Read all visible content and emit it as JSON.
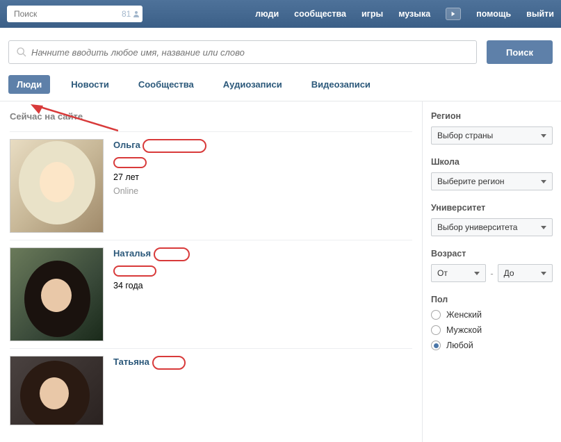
{
  "topNav": {
    "searchPlaceholder": "Поиск",
    "friendCount": "81",
    "links": {
      "people": "люди",
      "communities": "сообщества",
      "games": "игры",
      "music": "музыка",
      "help": "помощь",
      "logout": "выйти"
    }
  },
  "bigSearch": {
    "placeholder": "Начните вводить любое имя, название или слово",
    "button": "Поиск"
  },
  "tabs": {
    "people": "Люди",
    "news": "Новости",
    "communities": "Сообщества",
    "audio": "Аудиозаписи",
    "video": "Видеозаписи"
  },
  "sectionTitle": "Сейчас на сайте",
  "results": [
    {
      "name": "Ольга",
      "age": "27 лет",
      "status": "Online"
    },
    {
      "name": "Наталья",
      "age": "34 года",
      "status": ""
    },
    {
      "name": "Татьяна",
      "age": "",
      "status": ""
    }
  ],
  "filters": {
    "region": {
      "label": "Регион",
      "value": "Выбор страны"
    },
    "school": {
      "label": "Школа",
      "value": "Выберите регион"
    },
    "university": {
      "label": "Университет",
      "value": "Выбор университета"
    },
    "age": {
      "label": "Возраст",
      "from": "От",
      "to": "До"
    },
    "gender": {
      "label": "Пол",
      "options": {
        "female": "Женский",
        "male": "Мужской",
        "any": "Любой"
      },
      "selected": "any"
    }
  }
}
